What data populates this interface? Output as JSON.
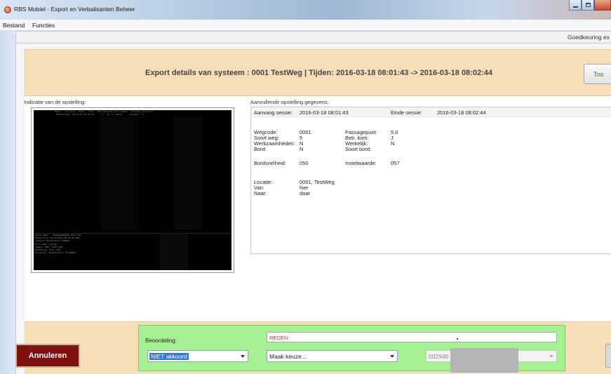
{
  "window": {
    "title": "RBS Mobiel - Export en Verbalisanten Beheer"
  },
  "menu": {
    "items": [
      "Bestand",
      "Functies"
    ]
  },
  "tabs": {
    "approval_label": "Goedkeuring ex"
  },
  "header": {
    "title": "Export details van systeem : 0001 TestWeg | Tijden: 2016-03-18 08:01:43 -> 2016-03-18 08:02:44",
    "top_button_label": "Too"
  },
  "left_panel": {
    "label": "Indicatie van de opstelling:"
  },
  "photo": {
    "top_text": "Meter   Toe-Ruim   Begin   Eind   Bez.Kenteken Richtnummer  Soortweg Kwalifica\n 0001A+0.000  00:01:43 00:02:44      0   Ja  5  PASSE      Onbekend  0",
    "info_text": "Feits 0001    0001000000076_001_0-00\nDatum tijd: 18-03-2016 08:01:43.000\nLocatie: Meldeffpunt TESW04\nOf a vaal: Teruge\nCamera: RBS: 32217 REC\nRechtsvwt: 37th: 0+0\nHristrust: Meldeffpunt: 0? BOK05"
  },
  "details": {
    "label": "Aanvullende opstelling gegevens:",
    "aanvang_sessie_label": "Aanvang sessie:",
    "aanvang_sessie_value": "2016-03-18 08:01:43",
    "einde_sessie_label": "Einde sessie:",
    "einde_sessie_value": "2016-03-18 08:02:44",
    "wegcode_label": "Wegcode:",
    "wegcode_value": "0001",
    "soort_weg_label": "Soort weg:",
    "soort_weg_value": "5",
    "werkzaamheden_label": "Werkzaamheden:",
    "werkzaamheden_value": "N",
    "bord_label": "Bord:",
    "bord_value": "N",
    "passagepunt_label": "Passagepunt:",
    "passagepunt_value": "5.0",
    "beb_kom_label": "Beb. kom:",
    "beb_kom_value": "J",
    "werkelijk_label": "Werkelijk:",
    "werkelijk_value": "N",
    "soort_bord_label": "Soort bord:",
    "soort_bord_value": "",
    "bordsnelheid_label": "Bordsnelheid:",
    "bordsnelheid_value": "050",
    "instelwaarde_label": "Instelwaarde:",
    "instelwaarde_value": "057",
    "locatie_label": "Locatie:",
    "locatie_value": "0001, TestWeg",
    "van_label": "Van:",
    "van_value": "hier",
    "naar_label": "Naar:",
    "naar_value": "daar"
  },
  "footer": {
    "annuleren_label": "Annuleren",
    "beoordeling_label": "Beoordeling:",
    "reden_label": "REDEN:",
    "beoordeling_selected": "NIET akkoord",
    "maak_keuze_selected": "Maak keuze...",
    "officer_selected": "002946"
  },
  "colors": {
    "header_band": "#f6deb8",
    "annuleren_bg": "#7f1010",
    "green_panel": "#a6f191",
    "reden_text": "#c0392b",
    "selection": "#3277d6"
  }
}
